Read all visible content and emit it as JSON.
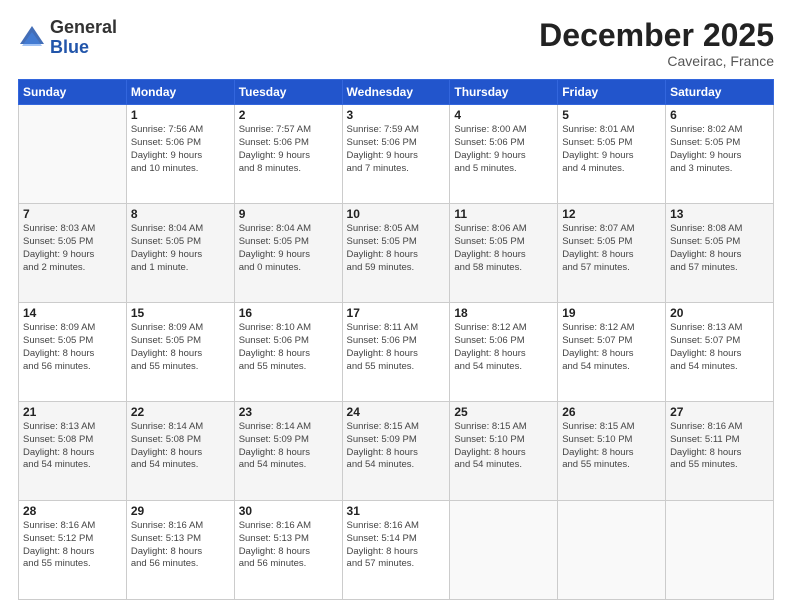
{
  "logo": {
    "general": "General",
    "blue": "Blue"
  },
  "title": "December 2025",
  "location": "Caveirac, France",
  "days_of_week": [
    "Sunday",
    "Monday",
    "Tuesday",
    "Wednesday",
    "Thursday",
    "Friday",
    "Saturday"
  ],
  "weeks": [
    [
      {
        "day": "",
        "info": ""
      },
      {
        "day": "1",
        "info": "Sunrise: 7:56 AM\nSunset: 5:06 PM\nDaylight: 9 hours\nand 10 minutes."
      },
      {
        "day": "2",
        "info": "Sunrise: 7:57 AM\nSunset: 5:06 PM\nDaylight: 9 hours\nand 8 minutes."
      },
      {
        "day": "3",
        "info": "Sunrise: 7:59 AM\nSunset: 5:06 PM\nDaylight: 9 hours\nand 7 minutes."
      },
      {
        "day": "4",
        "info": "Sunrise: 8:00 AM\nSunset: 5:06 PM\nDaylight: 9 hours\nand 5 minutes."
      },
      {
        "day": "5",
        "info": "Sunrise: 8:01 AM\nSunset: 5:05 PM\nDaylight: 9 hours\nand 4 minutes."
      },
      {
        "day": "6",
        "info": "Sunrise: 8:02 AM\nSunset: 5:05 PM\nDaylight: 9 hours\nand 3 minutes."
      }
    ],
    [
      {
        "day": "7",
        "info": "Sunrise: 8:03 AM\nSunset: 5:05 PM\nDaylight: 9 hours\nand 2 minutes."
      },
      {
        "day": "8",
        "info": "Sunrise: 8:04 AM\nSunset: 5:05 PM\nDaylight: 9 hours\nand 1 minute."
      },
      {
        "day": "9",
        "info": "Sunrise: 8:04 AM\nSunset: 5:05 PM\nDaylight: 9 hours\nand 0 minutes."
      },
      {
        "day": "10",
        "info": "Sunrise: 8:05 AM\nSunset: 5:05 PM\nDaylight: 8 hours\nand 59 minutes."
      },
      {
        "day": "11",
        "info": "Sunrise: 8:06 AM\nSunset: 5:05 PM\nDaylight: 8 hours\nand 58 minutes."
      },
      {
        "day": "12",
        "info": "Sunrise: 8:07 AM\nSunset: 5:05 PM\nDaylight: 8 hours\nand 57 minutes."
      },
      {
        "day": "13",
        "info": "Sunrise: 8:08 AM\nSunset: 5:05 PM\nDaylight: 8 hours\nand 57 minutes."
      }
    ],
    [
      {
        "day": "14",
        "info": "Sunrise: 8:09 AM\nSunset: 5:05 PM\nDaylight: 8 hours\nand 56 minutes."
      },
      {
        "day": "15",
        "info": "Sunrise: 8:09 AM\nSunset: 5:05 PM\nDaylight: 8 hours\nand 55 minutes."
      },
      {
        "day": "16",
        "info": "Sunrise: 8:10 AM\nSunset: 5:06 PM\nDaylight: 8 hours\nand 55 minutes."
      },
      {
        "day": "17",
        "info": "Sunrise: 8:11 AM\nSunset: 5:06 PM\nDaylight: 8 hours\nand 55 minutes."
      },
      {
        "day": "18",
        "info": "Sunrise: 8:12 AM\nSunset: 5:06 PM\nDaylight: 8 hours\nand 54 minutes."
      },
      {
        "day": "19",
        "info": "Sunrise: 8:12 AM\nSunset: 5:07 PM\nDaylight: 8 hours\nand 54 minutes."
      },
      {
        "day": "20",
        "info": "Sunrise: 8:13 AM\nSunset: 5:07 PM\nDaylight: 8 hours\nand 54 minutes."
      }
    ],
    [
      {
        "day": "21",
        "info": "Sunrise: 8:13 AM\nSunset: 5:08 PM\nDaylight: 8 hours\nand 54 minutes."
      },
      {
        "day": "22",
        "info": "Sunrise: 8:14 AM\nSunset: 5:08 PM\nDaylight: 8 hours\nand 54 minutes."
      },
      {
        "day": "23",
        "info": "Sunrise: 8:14 AM\nSunset: 5:09 PM\nDaylight: 8 hours\nand 54 minutes."
      },
      {
        "day": "24",
        "info": "Sunrise: 8:15 AM\nSunset: 5:09 PM\nDaylight: 8 hours\nand 54 minutes."
      },
      {
        "day": "25",
        "info": "Sunrise: 8:15 AM\nSunset: 5:10 PM\nDaylight: 8 hours\nand 54 minutes."
      },
      {
        "day": "26",
        "info": "Sunrise: 8:15 AM\nSunset: 5:10 PM\nDaylight: 8 hours\nand 55 minutes."
      },
      {
        "day": "27",
        "info": "Sunrise: 8:16 AM\nSunset: 5:11 PM\nDaylight: 8 hours\nand 55 minutes."
      }
    ],
    [
      {
        "day": "28",
        "info": "Sunrise: 8:16 AM\nSunset: 5:12 PM\nDaylight: 8 hours\nand 55 minutes."
      },
      {
        "day": "29",
        "info": "Sunrise: 8:16 AM\nSunset: 5:13 PM\nDaylight: 8 hours\nand 56 minutes."
      },
      {
        "day": "30",
        "info": "Sunrise: 8:16 AM\nSunset: 5:13 PM\nDaylight: 8 hours\nand 56 minutes."
      },
      {
        "day": "31",
        "info": "Sunrise: 8:16 AM\nSunset: 5:14 PM\nDaylight: 8 hours\nand 57 minutes."
      },
      {
        "day": "",
        "info": ""
      },
      {
        "day": "",
        "info": ""
      },
      {
        "day": "",
        "info": ""
      }
    ]
  ]
}
